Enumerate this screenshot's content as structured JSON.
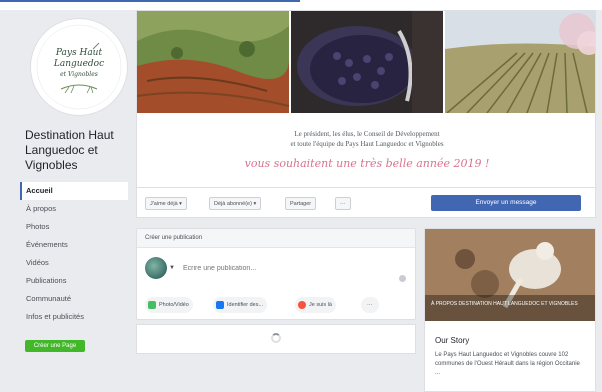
{
  "page": {
    "name": "Destination Haut Languedoc et Vignobles",
    "logo_text": [
      "Pays Haut",
      "Languedoc",
      "et Vignobles"
    ]
  },
  "nav": {
    "items": [
      {
        "label": "Accueil",
        "active": true
      },
      {
        "label": "À propos",
        "active": false
      },
      {
        "label": "Photos",
        "active": false
      },
      {
        "label": "Événements",
        "active": false
      },
      {
        "label": "Vidéos",
        "active": false
      },
      {
        "label": "Publications",
        "active": false
      },
      {
        "label": "Communauté",
        "active": false
      },
      {
        "label": "Infos et publicités",
        "active": false
      }
    ],
    "create_page": "Créer une Page"
  },
  "cover": {
    "line1": "Le président, les élus, le Conseil de Développement",
    "line2": "et toute l'équipe du Pays Haut Languedoc et Vignobles",
    "script": "vous souhaitent une très belle année 2019 !"
  },
  "actions": {
    "like": "J'aime déjà ▾",
    "follow": "Déjà abonné(e) ▾",
    "share": "Partager",
    "more": "···",
    "send_message": "Envoyer un message"
  },
  "composer": {
    "header": "Créer une publication",
    "placeholder": "Écrire une publication...",
    "photo_video": "Photo/Vidéo",
    "tag": "Identifier des...",
    "checkin": "Je suis là",
    "more": "···"
  },
  "story": {
    "image_caption": "À PROPOS DESTINATION HAUT LANGUEDOC ET VIGNOBLES",
    "title": "Our Story",
    "description": "Le Pays Haut Languedoc et Vignobles couvre 102 communes de l'Ouest Hérault dans la région Occitanie ..."
  },
  "colors": {
    "facebook_blue": "#4267b2",
    "green": "#42b72a",
    "script_pink": "#d9738f"
  }
}
